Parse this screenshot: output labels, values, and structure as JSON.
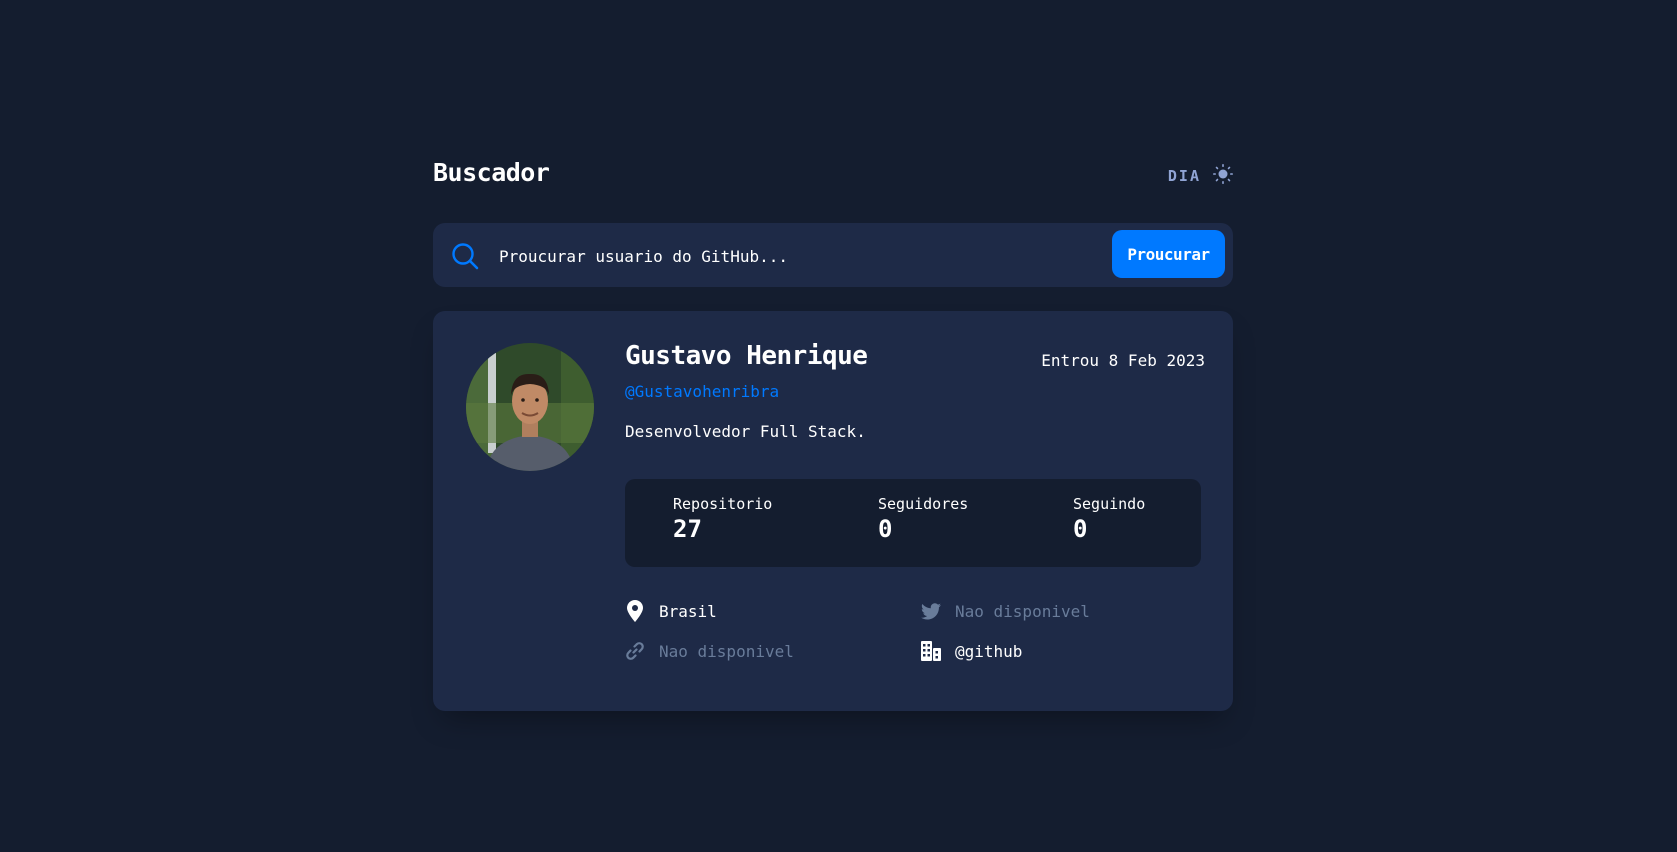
{
  "header": {
    "title": "Buscador",
    "theme_label": "DIA",
    "theme_icon": "sun-icon"
  },
  "search": {
    "placeholder": "Proucurar usuario do GitHub...",
    "icon": "search-icon",
    "button_label": "Proucurar"
  },
  "profile": {
    "name": "Gustavo Henrique",
    "login": "@Gustavohenribra",
    "joined": "Entrou 8 Feb 2023",
    "bio": "Desenvolvedor Full Stack.",
    "stats": {
      "repos_label": "Repositorio",
      "repos_value": "27",
      "followers_label": "Seguidores",
      "followers_value": "0",
      "following_label": "Seguindo",
      "following_value": "0"
    },
    "info": {
      "location": "Brasil",
      "twitter": "Nao disponivel",
      "blog": "Nao disponivel",
      "company": "@github"
    }
  },
  "colors": {
    "background": "#141d2f",
    "card": "#1e2a47",
    "accent": "#0079ff",
    "muted": "#697c9a"
  }
}
